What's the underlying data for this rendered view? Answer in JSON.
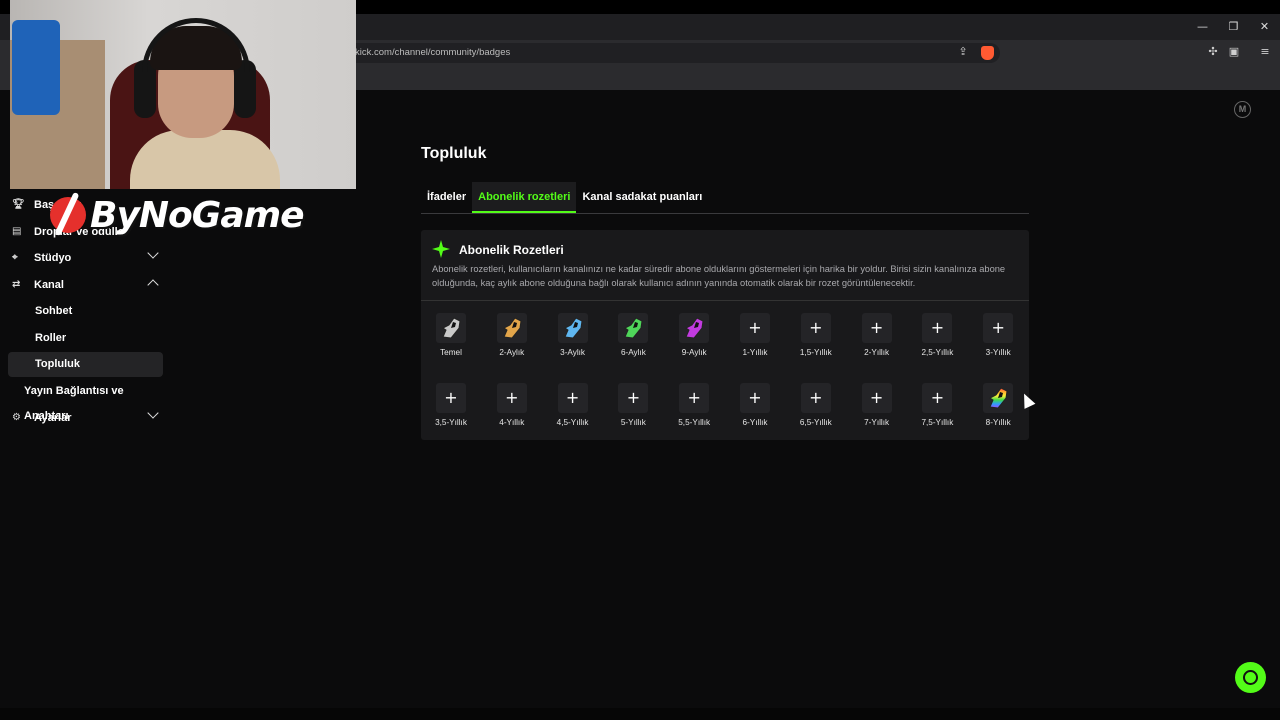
{
  "browser": {
    "url": "kick.com/channel/community/badges",
    "window_controls": [
      "—",
      "❐",
      "✕"
    ]
  },
  "overlay": {
    "logo_text": "ByNoGame"
  },
  "sidebar": {
    "items": [
      {
        "label": "Başarılar",
        "icon": "trophy-icon"
      },
      {
        "label": "Droplar ve ödüller",
        "icon": "gift-icon"
      },
      {
        "label": "Stüdyo",
        "icon": "studio-icon",
        "expanded": false
      },
      {
        "label": "Kanal",
        "icon": "channel-icon",
        "expanded": true
      },
      {
        "label": "Sohbet"
      },
      {
        "label": "Roller"
      },
      {
        "label": "Topluluk",
        "active": true
      },
      {
        "label": "Yayın Bağlantısı ve Anahtarı"
      },
      {
        "label": "Ayarlar",
        "icon": "gear-icon",
        "expanded": false
      }
    ]
  },
  "main": {
    "title": "Topluluk",
    "tabs": [
      {
        "label": "İfadeler"
      },
      {
        "label": "Abonelik rozetleri",
        "active": true
      },
      {
        "label": "Kanal sadakat puanları"
      }
    ],
    "card": {
      "title": "Abonelik Rozetleri",
      "description": "Abonelik rozetleri, kullanıcıların kanalınızı ne kadar süredir abone olduklarını göstermeleri için harika bir yoldur. Birisi sizin kanalınıza abone olduğunda, kaç aylık abone olduğuna bağlı olarak kullanıcı adının yanında otomatik olarak bir rozet görüntülenecektir.",
      "badges": [
        {
          "label": "Temel",
          "color": "#c9c9c9",
          "type": "image"
        },
        {
          "label": "2-Aylık",
          "color": "#e2a54a",
          "type": "image"
        },
        {
          "label": "3-Aylık",
          "color": "#5fb6f0",
          "type": "image"
        },
        {
          "label": "6-Aylık",
          "color": "#4fd65a",
          "type": "image"
        },
        {
          "label": "9-Aylık",
          "color": "#c23be0",
          "type": "image"
        },
        {
          "label": "1-Yıllık",
          "type": "add"
        },
        {
          "label": "1,5-Yıllık",
          "type": "add"
        },
        {
          "label": "2-Yıllık",
          "type": "add"
        },
        {
          "label": "2,5-Yıllık",
          "type": "add"
        },
        {
          "label": "3-Yıllık",
          "type": "add"
        },
        {
          "label": "3,5-Yıllık",
          "type": "add"
        },
        {
          "label": "4-Yıllık",
          "type": "add"
        },
        {
          "label": "4,5-Yıllık",
          "type": "add"
        },
        {
          "label": "5-Yıllık",
          "type": "add"
        },
        {
          "label": "5,5-Yıllık",
          "type": "add"
        },
        {
          "label": "6-Yıllık",
          "type": "add"
        },
        {
          "label": "6,5-Yıllık",
          "type": "add"
        },
        {
          "label": "7-Yıllık",
          "type": "add"
        },
        {
          "label": "7,5-Yıllık",
          "type": "add"
        },
        {
          "label": "8-Yıllık",
          "color": "rainbow",
          "type": "image"
        }
      ],
      "add_symbol": "+"
    }
  },
  "colors": {
    "accent": "#53fc18",
    "background": "#0b0b0c",
    "card": "#19191b"
  }
}
